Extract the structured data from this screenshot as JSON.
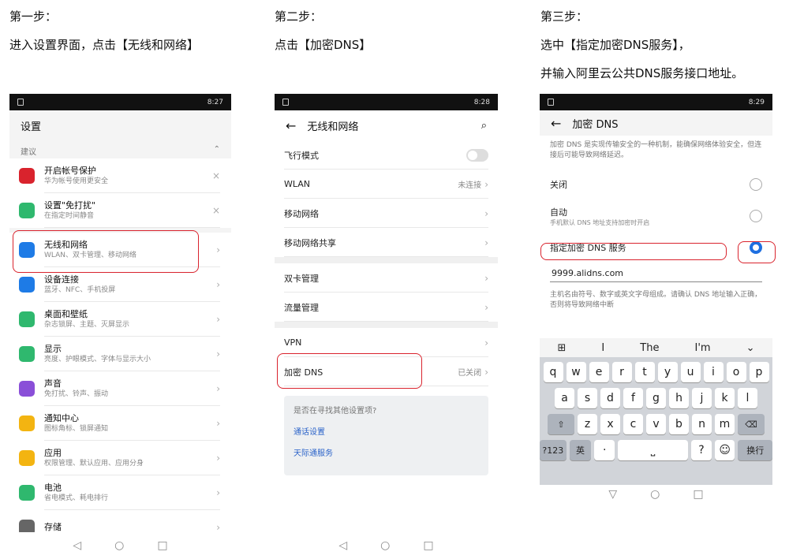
{
  "steps": [
    {
      "title": "第一步：",
      "desc": "进入设置界面，点击【无线和网络】"
    },
    {
      "title": "第二步：",
      "desc": "点击【加密DNS】"
    },
    {
      "title": "第三步：",
      "desc": "选中【指定加密DNS服务】，",
      "desc2": "并输入阿里云公共DNS服务接口地址。"
    }
  ],
  "phone1": {
    "time": "8:27",
    "title": "设置",
    "section": "建议",
    "items": [
      {
        "title": "开启帐号保护",
        "sub": "华为帐号使用更安全",
        "icon": "huawei-icon",
        "color": "#d9232d",
        "action": "×"
      },
      {
        "title": "设置\"免打扰\"",
        "sub": "在指定时间静音",
        "icon": "moon-icon",
        "color": "#2fb86e",
        "action": "×"
      },
      {
        "title": "无线和网络",
        "sub": "WLAN、双卡管理、移动网络",
        "icon": "wifi-icon",
        "color": "#1e7be6",
        "action": ">"
      },
      {
        "title": "设备连接",
        "sub": "蓝牙、NFC、手机投屏",
        "icon": "device-icon",
        "color": "#1e7be6",
        "action": ">"
      },
      {
        "title": "桌面和壁纸",
        "sub": "杂志锁屏、主题、灭屏显示",
        "icon": "wallpaper-icon",
        "color": "#2fb86e",
        "action": ">"
      },
      {
        "title": "显示",
        "sub": "亮度、护眼模式、字体与显示大小",
        "icon": "display-icon",
        "color": "#2fb86e",
        "action": ">"
      },
      {
        "title": "声音",
        "sub": "免打扰、铃声、振动",
        "icon": "sound-icon",
        "color": "#8a4fd8",
        "action": ">"
      },
      {
        "title": "通知中心",
        "sub": "图标角标、锁屏通知",
        "icon": "bell-icon",
        "color": "#f3b411",
        "action": ">"
      },
      {
        "title": "应用",
        "sub": "权限管理、默认应用、应用分身",
        "icon": "apps-icon",
        "color": "#f3b411",
        "action": ">"
      },
      {
        "title": "电池",
        "sub": "省电模式、耗电排行",
        "icon": "battery-icon",
        "color": "#2fb86e",
        "action": ">"
      },
      {
        "title": "存储",
        "sub": "",
        "icon": "storage-icon",
        "color": "#666666",
        "action": ">"
      }
    ]
  },
  "phone2": {
    "time": "8:28",
    "title": "无线和网络",
    "group1": [
      {
        "label": "飞行模式",
        "value": "",
        "type": "toggle"
      },
      {
        "label": "WLAN",
        "value": "未连接",
        "type": "arrow"
      },
      {
        "label": "移动网络",
        "value": "",
        "type": "arrow"
      },
      {
        "label": "移动网络共享",
        "value": "",
        "type": "arrow"
      }
    ],
    "group2": [
      {
        "label": "双卡管理",
        "value": "",
        "type": "arrow"
      },
      {
        "label": "流量管理",
        "value": "",
        "type": "arrow"
      }
    ],
    "group3": [
      {
        "label": "VPN",
        "value": "",
        "type": "arrow"
      },
      {
        "label": "加密 DNS",
        "value": "已关闭",
        "type": "arrow"
      }
    ],
    "help_q": "是否在寻找其他设置项?",
    "help_links": [
      "通话设置",
      "天际通服务"
    ]
  },
  "phone3": {
    "time": "8:29",
    "title": "加密 DNS",
    "desc": "加密 DNS 是实现传输安全的一种机制，能确保网络体验安全，但连接后可能导致网络延迟。",
    "options": [
      {
        "label": "关闭",
        "sub": "",
        "selected": false
      },
      {
        "label": "自动",
        "sub": "手机默认 DNS 地址支持加密时开启",
        "selected": false
      },
      {
        "label": "指定加密 DNS 服务",
        "sub": "",
        "selected": true
      }
    ],
    "dns_value": "9999.alidns.com",
    "hint": "主机名由符号、数字或英文字母组成。请确认 DNS 地址输入正确，否则将导致网络中断",
    "suggestions": [
      "I",
      "The",
      "I'm"
    ],
    "keys_row1": [
      "q",
      "w",
      "e",
      "r",
      "t",
      "y",
      "u",
      "i",
      "o",
      "p"
    ],
    "keys_row2": [
      "a",
      "s",
      "d",
      "f",
      "g",
      "h",
      "j",
      "k",
      "l"
    ],
    "keys_row3": [
      "z",
      "x",
      "c",
      "v",
      "b",
      "n",
      "m"
    ],
    "key_123": "?123",
    "key_lang": "英",
    "key_dot": "·",
    "key_q": "?",
    "key_enter": "换行"
  },
  "colors": {
    "highlight": "#d9232d",
    "link": "#2b63c9",
    "selected_radio": "#1e6fe0"
  }
}
